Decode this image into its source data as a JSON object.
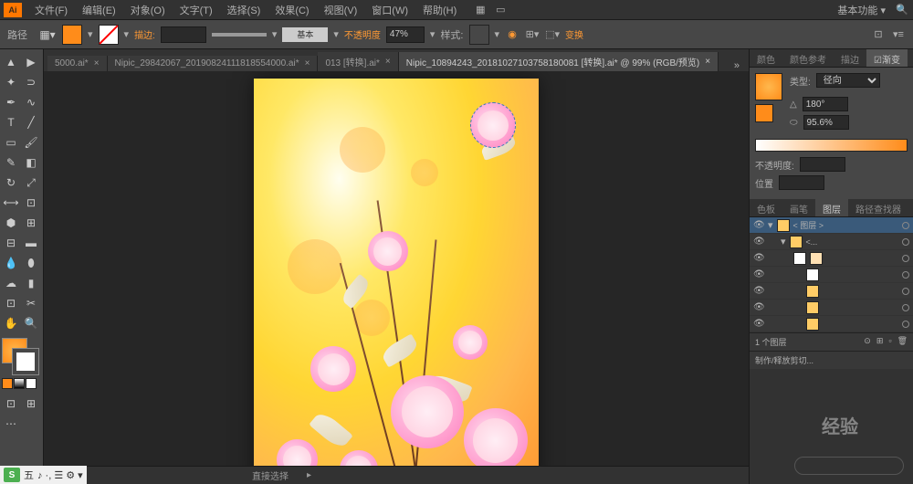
{
  "app": {
    "logo_text": "Ai"
  },
  "menu": {
    "items": [
      "文件(F)",
      "编辑(E)",
      "对象(O)",
      "文字(T)",
      "选择(S)",
      "效果(C)",
      "视图(V)",
      "窗口(W)",
      "帮助(H)"
    ],
    "workspace": "基本功能"
  },
  "control": {
    "path_label": "路径",
    "stroke_label": "描边:",
    "style_label": "基本",
    "opacity_label": "不透明度",
    "opacity_value": "47%",
    "style_dropdown": "样式:",
    "transform_label": "变换"
  },
  "tabs": [
    {
      "label": "5000.ai*",
      "active": false
    },
    {
      "label": "Nipic_29842067_20190824111818554000.ai*",
      "active": false
    },
    {
      "label": "013 [转换].ai*",
      "active": false
    },
    {
      "label": "Nipic_10894243_20181027103758180081 [转换].ai* @ 99% (RGB/预览)",
      "active": true
    }
  ],
  "status": {
    "zoom": "",
    "tool": "直接选择"
  },
  "panels": {
    "color_tabs": [
      "颜色",
      "颜色参考",
      "描边"
    ],
    "gradient_tab": "渐变",
    "type_label": "类型:",
    "type_value": "径向",
    "angle_label": "",
    "angle_value": "180°",
    "scale_value": "95.6%",
    "opacity_label": "不透明度:",
    "position_label": "位置",
    "swatch_tabs": [
      "色板",
      "画笔",
      "图层",
      "路径查找器"
    ],
    "layer_group": "< 图层 >",
    "layer_sub": "<...",
    "layer_count": "1 个图层",
    "layer_footer": "制作/释放剪切..."
  },
  "taskbar": {
    "ime_icon": "S",
    "ime_text": "五",
    "icons": "♪ ·, ☰ ⚙ ▾"
  },
  "watermark": "经验"
}
